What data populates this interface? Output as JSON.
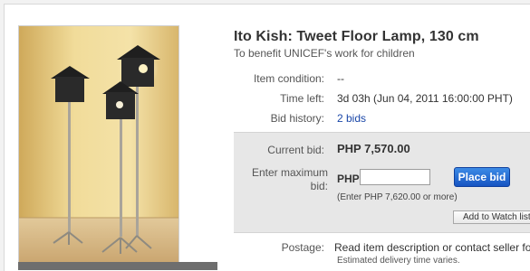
{
  "listing": {
    "title": "Ito Kish: Tweet Floor Lamp, 130 cm",
    "subtitle": "To benefit UNICEF's work for children"
  },
  "details": {
    "condition_label": "Item condition:",
    "condition_value": "--",
    "time_left_label": "Time left:",
    "time_left_value": "3d 03h (Jun 04, 2011 16:00:00 PHT)",
    "bid_history_label": "Bid history:",
    "bid_history_value": "2 bids"
  },
  "bid": {
    "current_bid_label": "Current bid:",
    "current_bid_value": "PHP 7,570.00",
    "max_bid_label": "Enter maximum bid:",
    "currency": "PHP",
    "input_value": "",
    "place_bid_label": "Place bid",
    "hint": "(Enter PHP 7,620.00 or more)",
    "watch_label": "Add to Watch list"
  },
  "postage": {
    "label": "Postage:",
    "value": "Read item description or contact seller for d",
    "delivery": "Estimated delivery time varies."
  },
  "colors": {
    "link": "#1a47a8",
    "button": "#1f63d6",
    "panel": "#e7e7e7"
  }
}
